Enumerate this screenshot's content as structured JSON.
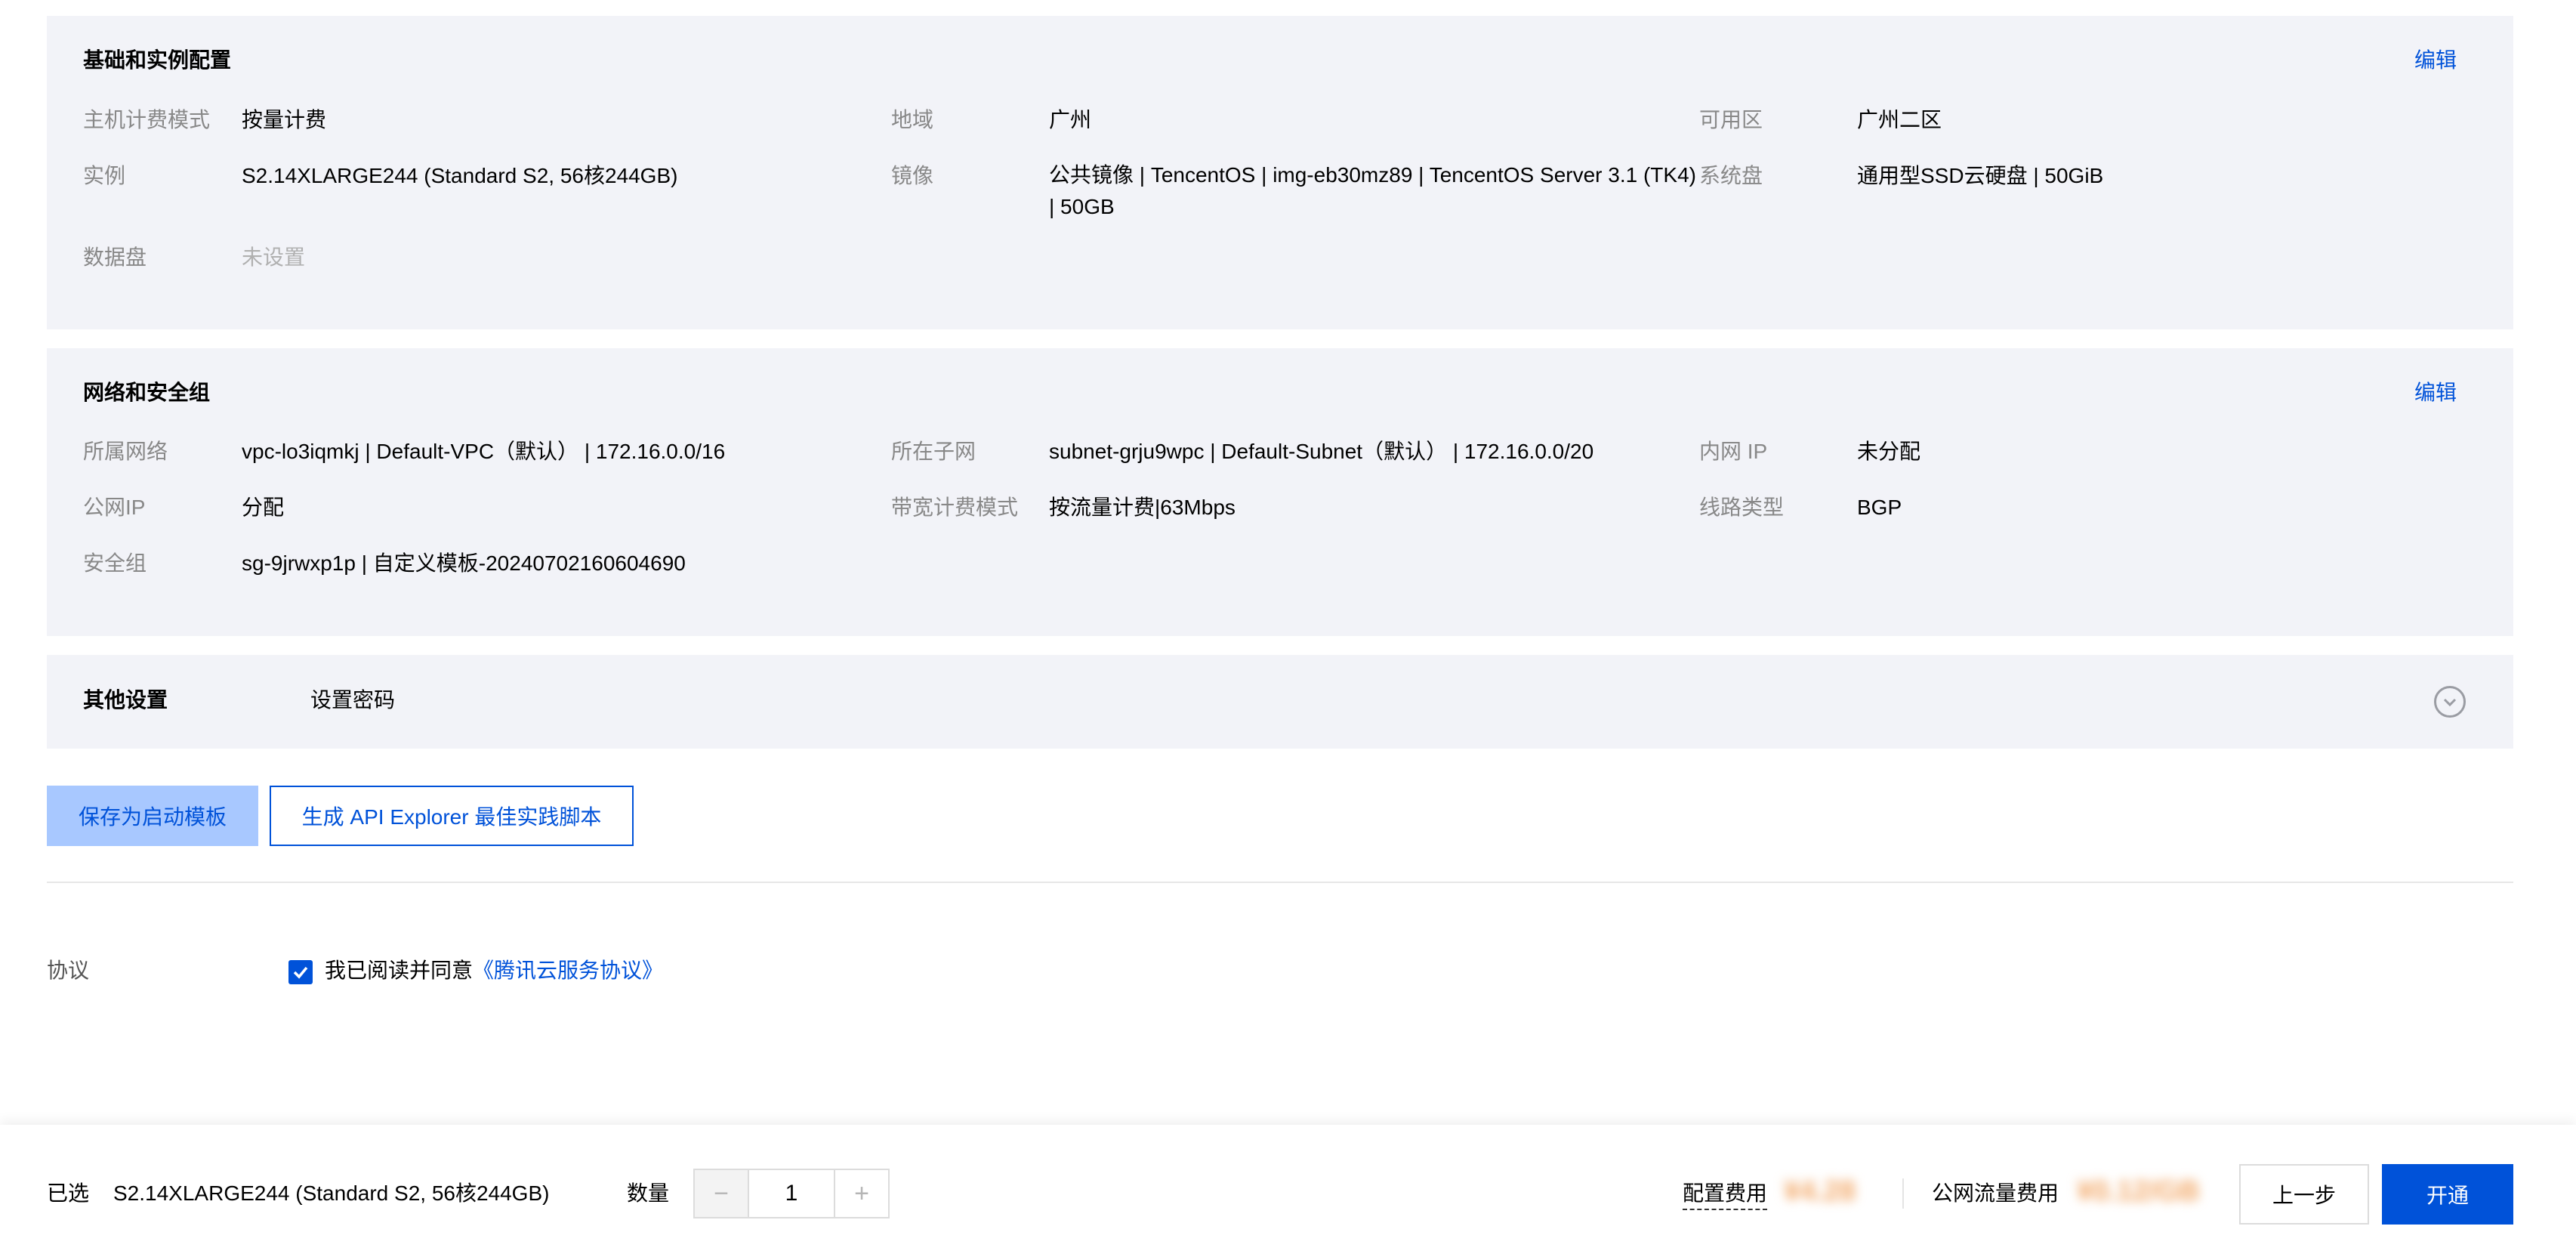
{
  "basic_section": {
    "title": "基础和实例配置",
    "edit": "编辑",
    "billing_mode_label": "主机计费模式",
    "billing_mode_value": "按量计费",
    "region_label": "地域",
    "region_value": "广州",
    "zone_label": "可用区",
    "zone_value": "广州二区",
    "instance_label": "实例",
    "instance_value": "S2.14XLARGE244 (Standard S2, 56核244GB)",
    "image_label": "镜像",
    "image_value": "公共镜像 | TencentOS | img-eb30mz89 | TencentOS Server 3.1 (TK4) | 50GB",
    "system_disk_label": "系统盘",
    "system_disk_value": "通用型SSD云硬盘 | 50GiB",
    "data_disk_label": "数据盘",
    "data_disk_value": "未设置"
  },
  "network_section": {
    "title": "网络和安全组",
    "edit": "编辑",
    "vpc_label": "所属网络",
    "vpc_value": "vpc-lo3iqmkj | Default-VPC（默认） | 172.16.0.0/16",
    "subnet_label": "所在子网",
    "subnet_value": "subnet-grju9wpc | Default-Subnet（默认） | 172.16.0.0/20",
    "private_ip_label": "内网 IP",
    "private_ip_value": "未分配",
    "public_ip_label": "公网IP",
    "public_ip_value": "分配",
    "bandwidth_label": "带宽计费模式",
    "bandwidth_value": "按流量计费|63Mbps",
    "line_label": "线路类型",
    "line_value": "BGP",
    "security_group_label": "安全组",
    "security_group_value": "sg-9jrwxp1p | 自定义模板-20240702160604690"
  },
  "other_section": {
    "title": "其他设置",
    "value": "设置密码",
    "expand_icon": "chevron-down-circle-icon"
  },
  "actions": {
    "save_template": "保存为启动模板",
    "api_explorer": "生成 API Explorer 最佳实践脚本"
  },
  "agreement": {
    "label": "协议",
    "checked": true,
    "text": "我已阅读并同意",
    "link": "《腾讯云服务协议》"
  },
  "footer": {
    "selected_label": "已选",
    "selected_value": "S2.14XLARGE244 (Standard S2, 56核244GB)",
    "quantity_label": "数量",
    "quantity_value": "1",
    "minus_symbol": "−",
    "plus_symbol": "+",
    "config_fee_label": "配置费用",
    "config_fee_value": "¥4.28",
    "traffic_fee_label": "公网流量费用",
    "traffic_fee_value": "¥0.12/GB",
    "prev_button": "上一步",
    "open_button": "开通"
  },
  "colors": {
    "accent": "#0052d9",
    "panel_bg": "#f2f3f8",
    "save_button_bg": "#a8c8ff",
    "price_blur": "#f2a766"
  }
}
